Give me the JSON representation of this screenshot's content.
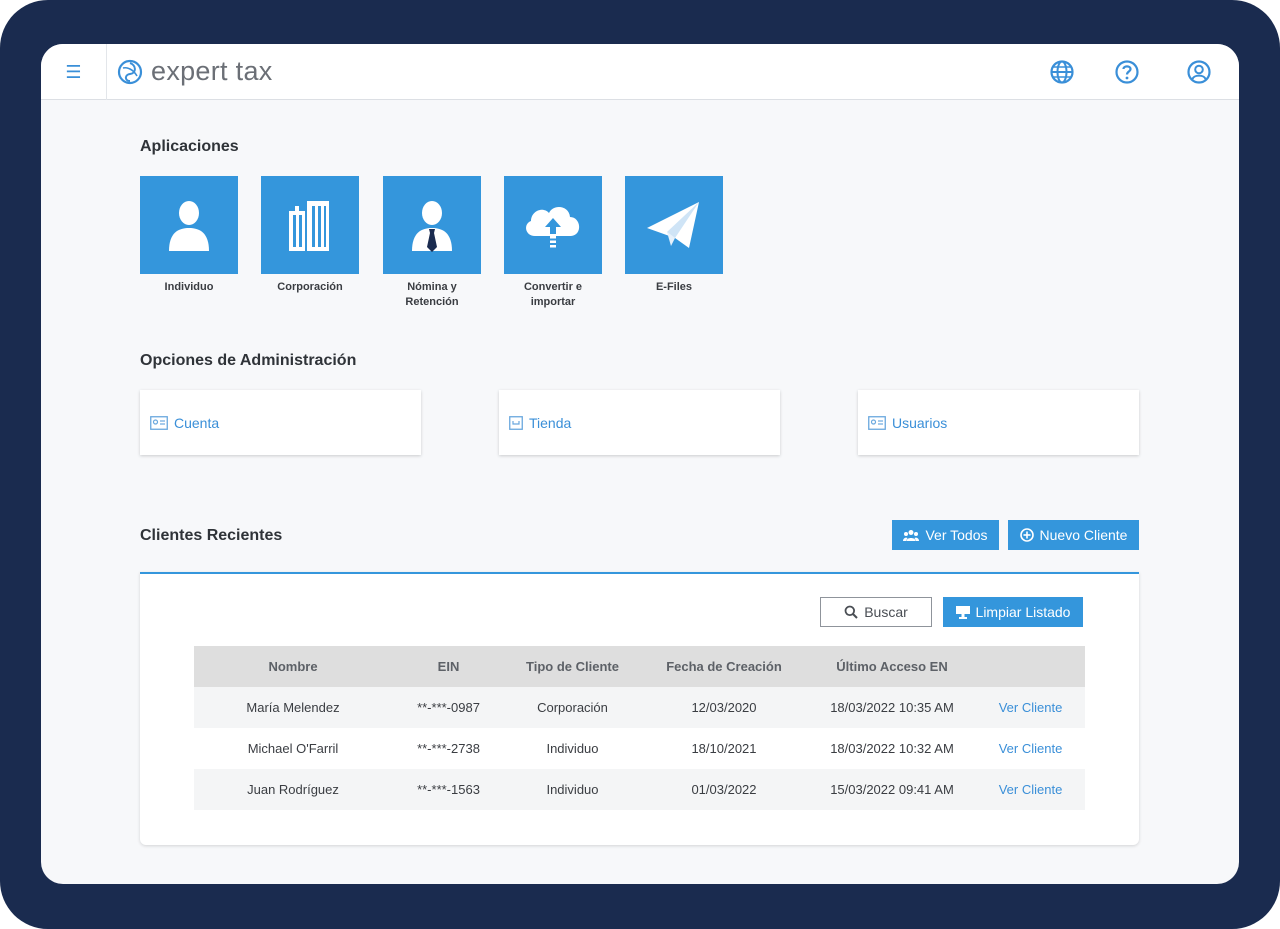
{
  "header": {
    "brand": "expert tax",
    "menu_icon": "hamburger-icon",
    "icons": [
      "globe-icon",
      "help-icon",
      "user-account-icon"
    ]
  },
  "applications": {
    "title": "Aplicaciones",
    "tiles": [
      {
        "label": "Individuo",
        "icon": "person-icon"
      },
      {
        "label": "Corporación",
        "icon": "buildings-icon"
      },
      {
        "label": "Nómina y Retención",
        "icon": "employee-tie-icon"
      },
      {
        "label": "Convertir e importar",
        "icon": "cloud-upload-icon"
      },
      {
        "label": "E-Files",
        "icon": "paper-plane-icon"
      }
    ]
  },
  "admin": {
    "title": "Opciones de Administración",
    "cards": [
      {
        "label": "Cuenta",
        "icon": "id-card-icon"
      },
      {
        "label": "Tienda",
        "icon": "store-icon"
      },
      {
        "label": "Usuarios",
        "icon": "users-card-icon"
      }
    ]
  },
  "clients": {
    "title": "Clientes Recientes",
    "view_all": "Ver Todos",
    "new_client": "Nuevo Cliente",
    "search": "Buscar",
    "clear": "Limpiar Listado",
    "columns": [
      "Nombre",
      "EIN",
      "Tipo de Cliente",
      "Fecha de Creación",
      "Último Acceso EN",
      ""
    ],
    "rows": [
      {
        "name": "María Melendez",
        "ein": "**-***-0987",
        "type": "Corporación",
        "created": "12/03/2020",
        "last_access": "18/03/2022 10:35 AM",
        "action": "Ver Cliente"
      },
      {
        "name": "Michael O'Farril",
        "ein": "**-***-2738",
        "type": "Individuo",
        "created": "18/10/2021",
        "last_access": "18/03/2022 10:32 AM",
        "action": "Ver Cliente"
      },
      {
        "name": "Juan Rodríguez",
        "ein": "**-***-1563",
        "type": "Individuo",
        "created": "01/03/2022",
        "last_access": "15/03/2022 09:41 AM",
        "action": "Ver Cliente"
      }
    ]
  },
  "colors": {
    "accent": "#3496dc",
    "frame": "#1a2b4f"
  }
}
